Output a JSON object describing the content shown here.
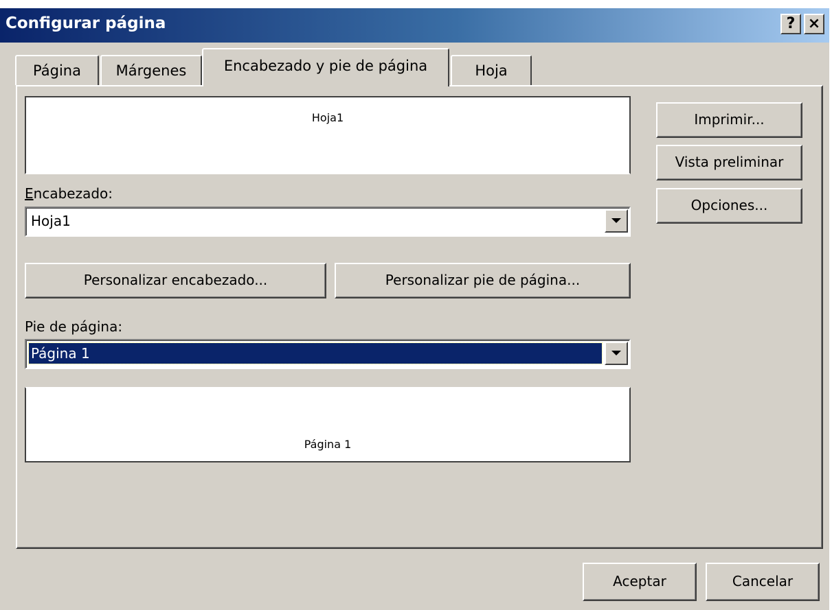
{
  "window": {
    "title": "Configurar página",
    "help_label": "?",
    "close_label": "×"
  },
  "tabs": [
    {
      "label": "Página",
      "active": false
    },
    {
      "label": "Márgenes",
      "active": false
    },
    {
      "label": "Encabezado y pie de página",
      "active": true
    },
    {
      "label": "Hoja",
      "active": false
    }
  ],
  "header_preview": {
    "text": "Hoja1"
  },
  "header": {
    "label": "Encabezado:",
    "value": "Hoja1"
  },
  "buttons": {
    "customize_header": "Personalizar encabezado...",
    "customize_footer": "Personalizar pie de página...",
    "print": "Imprimir...",
    "preview": "Vista preliminar",
    "options": "Opciones...",
    "ok": "Aceptar",
    "cancel": "Cancelar"
  },
  "footer": {
    "label": "Pie de página:",
    "value": "Página 1"
  },
  "footer_preview": {
    "text": "Página 1"
  },
  "colors": {
    "dialog_bg": "#d4d0c8",
    "title_bar_start": "#0a246a",
    "title_bar_end": "#a6caf0",
    "selection": "#0a246a"
  }
}
